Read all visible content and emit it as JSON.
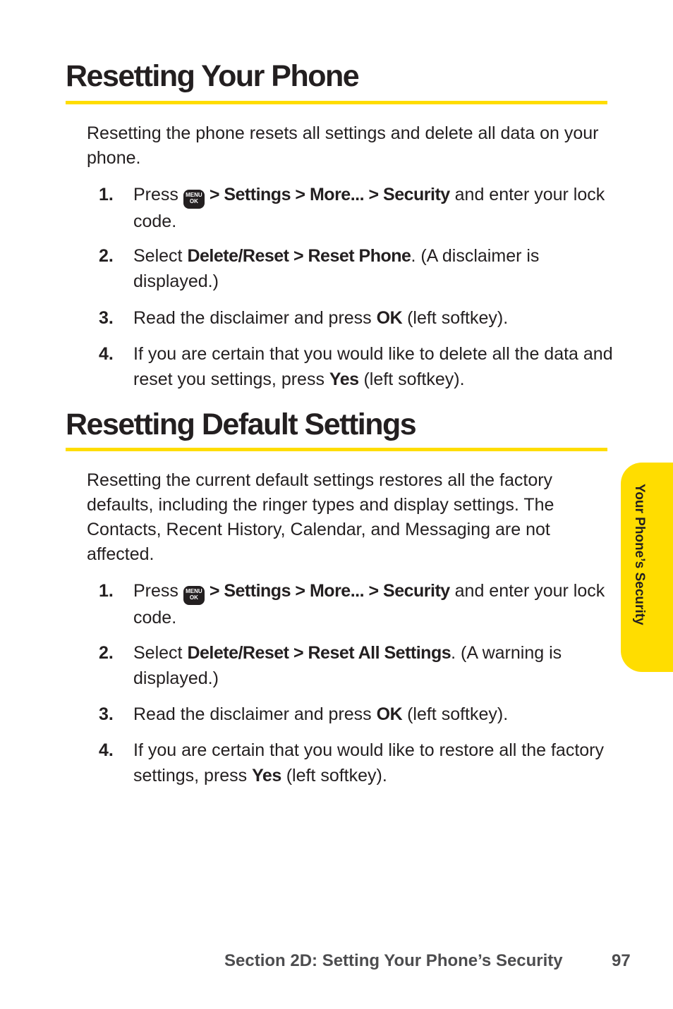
{
  "section1": {
    "title": "Resetting Your Phone",
    "intro": "Resetting the phone resets all settings and delete all data on your phone.",
    "steps": [
      {
        "num": "1.",
        "pre": "Press",
        "icon": "menu-ok-key",
        "bold": "> Settings > More... > Security",
        "post": " and enter your lock code."
      },
      {
        "num": "2.",
        "pre": "Select ",
        "bold": "Delete/Reset > Reset Phone",
        "post": ". (A disclaimer is displayed.)"
      },
      {
        "num": "3.",
        "pre": "Read the disclaimer and press ",
        "bold": "OK",
        "post": " (left softkey)."
      },
      {
        "num": "4.",
        "pre": "If you are certain that you would like to delete all the data and reset you settings, press ",
        "bold": "Yes",
        "post": " (left softkey)."
      }
    ]
  },
  "section2": {
    "title": "Resetting Default Settings",
    "intro": "Resetting the current default settings restores all the factory defaults, including the ringer types and display settings. The Contacts, Recent History, Calendar, and Messaging are not affected.",
    "steps": [
      {
        "num": "1.",
        "pre": "Press",
        "icon": "menu-ok-key",
        "bold": "> Settings > More... > Security",
        "post": " and enter your lock code."
      },
      {
        "num": "2.",
        "pre": "Select ",
        "bold": "Delete/Reset > Reset All Settings",
        "post": ". (A warning is displayed.)"
      },
      {
        "num": "3.",
        "pre": "Read the disclaimer and press ",
        "bold": "OK",
        "post": " (left softkey)."
      },
      {
        "num": "4.",
        "pre": "If you are certain that you would like to restore all the factory settings, press ",
        "bold": "Yes",
        "post": " (left softkey)."
      }
    ]
  },
  "menu_key": {
    "line1": "MENU",
    "line2": "OK"
  },
  "side_tab": {
    "label": "Your Phone’s Security"
  },
  "footer": {
    "section": "Section 2D: Setting Your Phone’s Security",
    "page": "97"
  },
  "colors": {
    "accent": "#ffdd00",
    "text": "#231f20",
    "footer": "#4d4d4f"
  }
}
